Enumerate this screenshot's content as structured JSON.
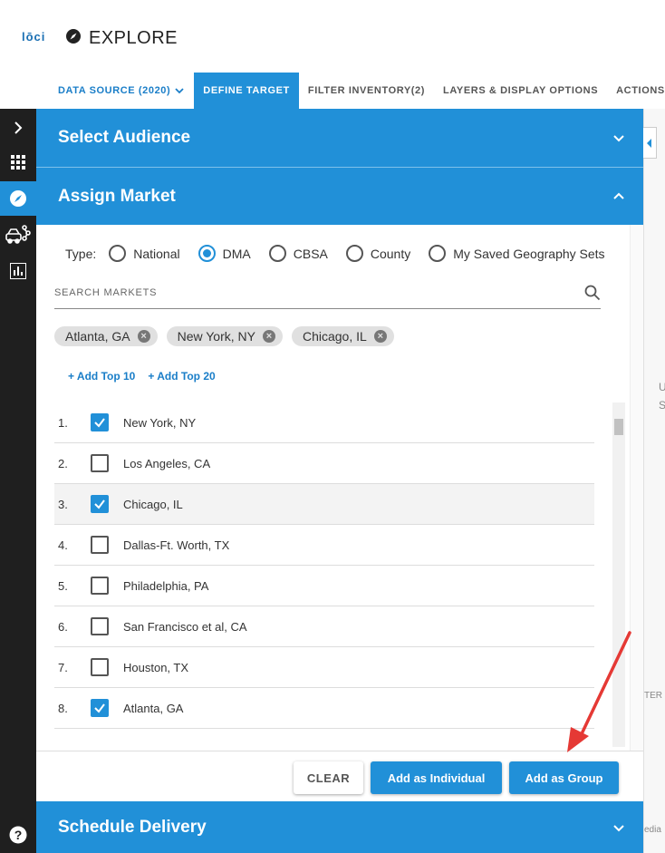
{
  "app": {
    "logo_text": "lōci",
    "page_title": "EXPLORE"
  },
  "tabs": [
    {
      "label": "DATA SOURCE (2020)"
    },
    {
      "label": "DEFINE TARGET"
    },
    {
      "label": "FILTER INVENTORY(2)"
    },
    {
      "label": "LAYERS & DISPLAY OPTIONS"
    },
    {
      "label": "ACTIONS"
    }
  ],
  "rail": {
    "items": [
      "expand-icon",
      "grid-icon",
      "compass-icon",
      "vehicles-icon",
      "bar-chart-icon"
    ],
    "help_icon": "help-icon"
  },
  "sections": {
    "select_audience": "Select Audience",
    "assign_market": "Assign Market",
    "schedule_delivery": "Schedule Delivery"
  },
  "assign": {
    "type_label": "Type:",
    "type_options": [
      {
        "label": "National",
        "selected": false
      },
      {
        "label": "DMA",
        "selected": true
      },
      {
        "label": "CBSA",
        "selected": false
      },
      {
        "label": "County",
        "selected": false
      },
      {
        "label": "My Saved Geography Sets",
        "selected": false
      }
    ],
    "search_placeholder": "SEARCH MARKETS",
    "chips": [
      "Atlanta, GA",
      "New York, NY",
      "Chicago, IL"
    ],
    "add_top_10": "+ Add Top 10",
    "add_top_20": "+ Add Top 20",
    "markets": [
      {
        "rank": "1.",
        "name": "New York, NY",
        "checked": true
      },
      {
        "rank": "2.",
        "name": "Los Angeles, CA",
        "checked": false
      },
      {
        "rank": "3.",
        "name": "Chicago, IL",
        "checked": true
      },
      {
        "rank": "4.",
        "name": "Dallas-Ft. Worth, TX",
        "checked": false
      },
      {
        "rank": "5.",
        "name": "Philadelphia, PA",
        "checked": false
      },
      {
        "rank": "6.",
        "name": "San Francisco et al, CA",
        "checked": false
      },
      {
        "rank": "7.",
        "name": "Houston, TX",
        "checked": false
      },
      {
        "rank": "8.",
        "name": "Atlanta, GA",
        "checked": true
      }
    ],
    "buttons": {
      "clear": "CLEAR",
      "add_individual": "Add as Individual",
      "add_group": "Add as Group"
    }
  },
  "map": {
    "fragments": [
      "U",
      "S",
      "TER",
      "edia"
    ]
  },
  "colors": {
    "accent": "#2190d8",
    "rail": "#1f1f1f",
    "annotation_arrow": "#e53935"
  }
}
